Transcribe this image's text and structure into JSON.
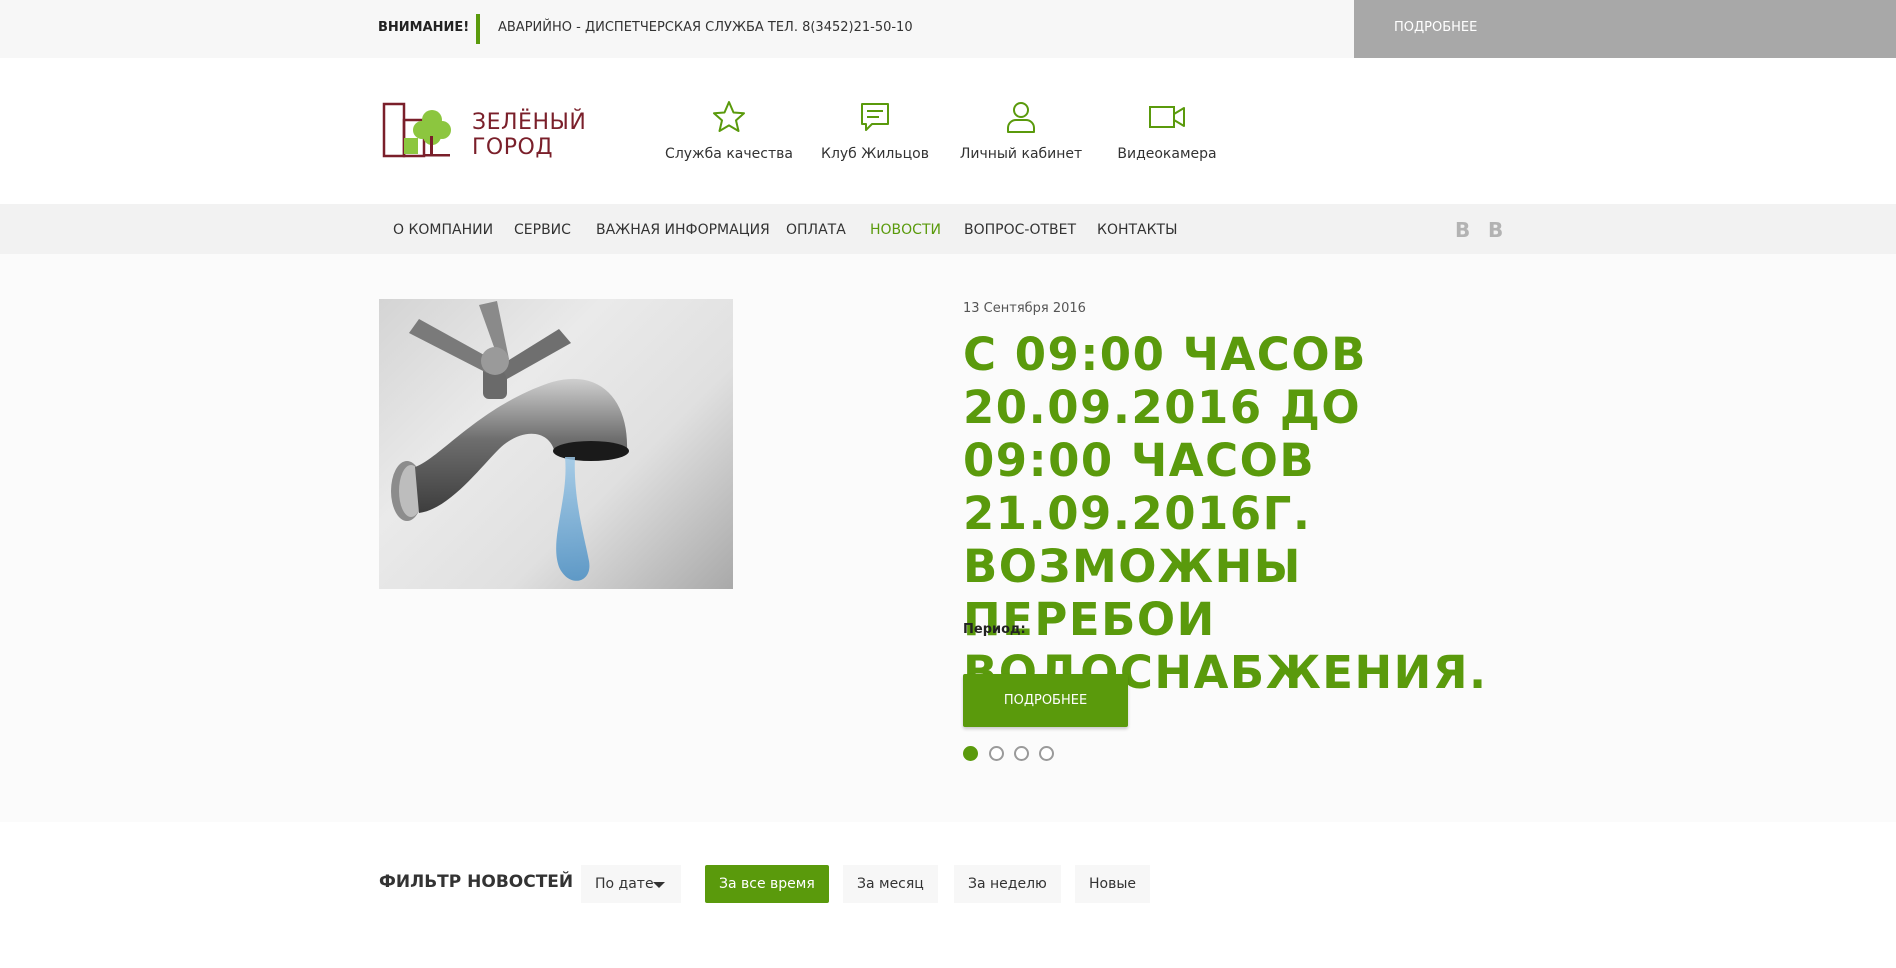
{
  "alert": {
    "label": "ВНИМАНИЕ!",
    "text": "АВАРИЙНО - ДИСПЕТЧЕРСКАЯ СЛУЖБА ТЕЛ. 8(3452)21-50-10",
    "more": "ПОДРОБНЕЕ"
  },
  "logo": {
    "line1": "ЗЕЛЁНЫЙ",
    "line2": "ГОРОД"
  },
  "quick_links": [
    {
      "label": "Служба качества",
      "icon": "star-icon"
    },
    {
      "label": "Клуб Жильцов",
      "icon": "chat-icon"
    },
    {
      "label": "Личный кабинет",
      "icon": "user-icon"
    },
    {
      "label": "Видеокамера",
      "icon": "video-camera-icon"
    }
  ],
  "nav": {
    "items": [
      "О КОМПАНИИ",
      "СЕРВИС",
      "ВАЖНАЯ ИНФОРМАЦИЯ",
      "ОПЛАТА",
      "НОВОСТИ",
      "ВОПРОС-ОТВЕТ",
      "КОНТАКТЫ"
    ],
    "active": "НОВОСТИ",
    "social": [
      "В",
      "В"
    ]
  },
  "slide": {
    "date": "13 Сентября 2016",
    "title": "С 09:00 ЧАСОВ 20.09.2016 ДО 09:00 ЧАСОВ 21.09.2016Г. ВОЗМОЖНЫ ПЕРЕБОИ ВОДОСНАБЖЕНИЯ.",
    "period_label": "Период:",
    "more": "ПОДРОБНЕЕ",
    "dots_total": 4,
    "dot_active": 1
  },
  "filter": {
    "title": "ФИЛЬТР НОВОСТЕЙ",
    "sort_selected": "По дате",
    "options": [
      "За все время",
      "За месяц",
      "За неделю",
      "Новые"
    ],
    "active_option": "За все время"
  },
  "colors": {
    "brand_green": "#5a9a0c",
    "brand_maroon": "#7a1f2a",
    "grey_button": "#a8a8a8"
  }
}
